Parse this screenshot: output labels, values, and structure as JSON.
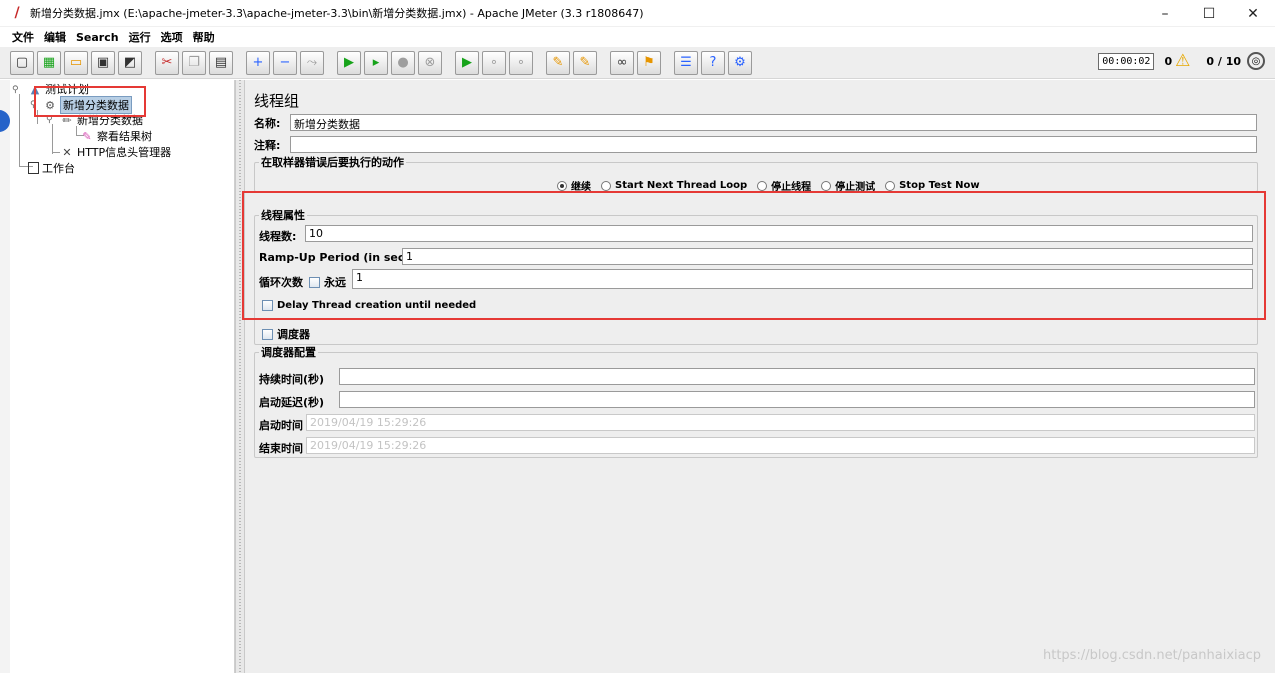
{
  "window": {
    "title": "新增分类数据.jmx (E:\\apache-jmeter-3.3\\apache-jmeter-3.3\\bin\\新增分类数据.jmx) - Apache JMeter (3.3 r1808647)",
    "icon": "jmeter-feather-icon",
    "controls": {
      "minimize": "–",
      "maximize": "☐",
      "close": "✕"
    }
  },
  "menu": [
    "文件",
    "编辑",
    "Search",
    "运行",
    "选项",
    "帮助"
  ],
  "toolbar": {
    "timer": "00:00:02",
    "warnings": "0",
    "threads": "0 / 10"
  },
  "tree": {
    "items": [
      {
        "label": "测试计划",
        "icon": "test-plan-icon"
      },
      {
        "label": "新增分类数据",
        "icon": "thread-group-gear-icon",
        "selected": true
      },
      {
        "label": "新增分类数据",
        "icon": "http-sampler-icon"
      },
      {
        "label": "察看结果树",
        "icon": "results-tree-icon"
      },
      {
        "label": "HTTP信息头管理器",
        "icon": "header-manager-icon"
      },
      {
        "label": "工作台",
        "icon": "workbench-icon"
      }
    ]
  },
  "panel": {
    "title": "线程组",
    "name_label": "名称:",
    "name_value": "新增分类数据",
    "comment_label": "注释:",
    "comment_value": "",
    "error_action": {
      "legend": "在取样器错误后要执行的动作",
      "options": [
        "继续",
        "Start Next Thread Loop",
        "停止线程",
        "停止测试",
        "Stop Test Now"
      ],
      "selected_index": 0
    },
    "thread_props": {
      "legend": "线程属性",
      "threads_label": "线程数:",
      "threads_value": "10",
      "rampup_label": "Ramp-Up Period (in seconds):",
      "rampup_value": "1",
      "loop_label": "循环次数",
      "forever_label": "永远",
      "forever_checked": false,
      "loop_value": "1",
      "delay_label": "Delay Thread creation until needed",
      "delay_checked": false
    },
    "scheduler": {
      "label": "调度器",
      "checked": false
    },
    "scheduler_config": {
      "legend": "调度器配置",
      "duration_label": "持续时间(秒)",
      "duration_value": "",
      "delay_label": "启动延迟(秒)",
      "delay_value": "",
      "start_label": "启动时间",
      "start_value": "2019/04/19 15:29:26",
      "end_label": "结束时间",
      "end_value": "2019/04/19 15:29:26"
    }
  },
  "watermark": "https://blog.csdn.net/panhaixiacp",
  "colors": {
    "highlight_box": "#e53935",
    "selection": "#b8cfe5"
  }
}
